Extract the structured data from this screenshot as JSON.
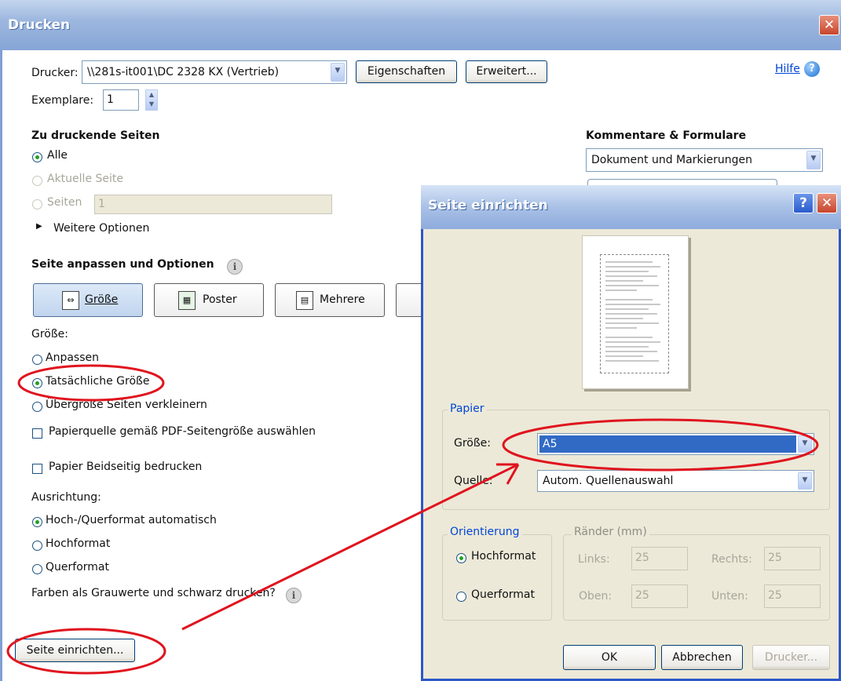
{
  "main": {
    "title": "Drucken",
    "close": "✕",
    "printer_label": "Drucker:",
    "printer_value": "\\\\281s-it001\\DC 2328 KX (Vertrieb)",
    "properties_button": "Eigenschaften",
    "advanced_button": "Erweitert...",
    "help_link": "Hilfe",
    "copies_label": "Exemplare:",
    "copies_value": "1",
    "pages_heading": "Zu druckende Seiten",
    "pages_options": [
      "Alle",
      "Aktuelle Seite",
      "Seiten"
    ],
    "pages_range_value": "1",
    "more_options": "Weitere Optionen",
    "comments_heading": "Kommentare & Formulare",
    "comments_value": "Dokument und Markierungen",
    "fit_heading": "Seite anpassen und Optionen",
    "fit_buttons": [
      "Größe",
      "Poster",
      "Mehrere"
    ],
    "size_label": "Größe:",
    "size_options": [
      "Anpassen",
      "Tatsächliche Größe",
      "Übergroße Seiten verkleinern"
    ],
    "checkbox_pdf_size": "Papierquelle gemäß PDF-Seitengröße auswählen",
    "checkbox_duplex": "Papier Beidseitig bedrucken",
    "orientation_label": "Ausrichtung:",
    "orientation_options": [
      "Hoch-/Querformat automatisch",
      "Hochformat",
      "Querformat"
    ],
    "grayscale_label": "Farben als Grauwerte und schwarz drucken?",
    "page_setup_button": "Seite einrichten..."
  },
  "page_setup": {
    "title": "Seite einrichten",
    "help_button": "?",
    "close": "✕",
    "paper_group": "Papier",
    "size_label": "Größe:",
    "size_value": "A5",
    "source_label": "Quelle:",
    "source_value": "Autom. Quellenauswahl",
    "orientation_group": "Orientierung",
    "portrait": "Hochformat",
    "landscape": "Querformat",
    "margins_group": "Ränder (mm)",
    "left_label": "Links:",
    "left_value": "25",
    "right_label": "Rechts:",
    "right_value": "25",
    "top_label": "Oben:",
    "top_value": "25",
    "bottom_label": "Unten:",
    "bottom_value": "25",
    "ok_button": "OK",
    "cancel_button": "Abbrechen",
    "printer_button": "Drucker..."
  },
  "colors": {
    "annotation": "#e0141e",
    "title_blue": "#0046d5",
    "selection": "#316ac5"
  }
}
